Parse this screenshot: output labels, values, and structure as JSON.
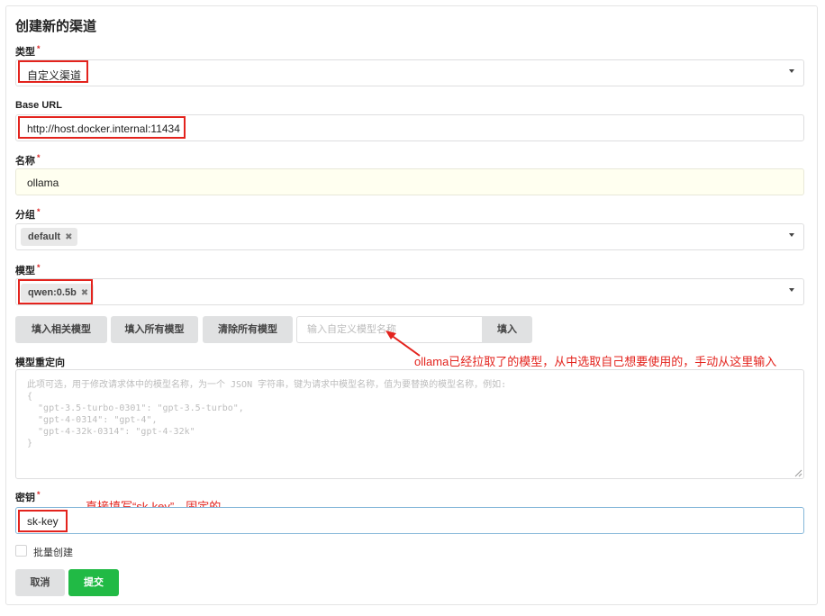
{
  "page": {
    "title": "创建新的渠道"
  },
  "form": {
    "type": {
      "label": "类型",
      "required_mark": "*",
      "value": "自定义渠道"
    },
    "base_url": {
      "label": "Base URL",
      "value": "http://host.docker.internal:11434"
    },
    "name": {
      "label": "名称",
      "required_mark": "*",
      "value": "ollama"
    },
    "group": {
      "label": "分组",
      "required_mark": "*",
      "chips": [
        "default"
      ],
      "chip_remove": "✖"
    },
    "model": {
      "label": "模型",
      "required_mark": "*",
      "chips": [
        "qwen:0.5b"
      ],
      "chip_remove": "✖"
    },
    "model_buttons": {
      "fill_related": "填入相关模型",
      "fill_all": "填入所有模型",
      "clear_all": "清除所有模型",
      "custom_placeholder": "输入自定义模型名称",
      "fill": "填入"
    },
    "model_mapping": {
      "label": "模型重定向",
      "placeholder": "此项可选，用于修改请求体中的模型名称，为一个 JSON 字符串，键为请求中模型名称，值为要替换的模型名称，例如:\n{\n  \"gpt-3.5-turbo-0301\": \"gpt-3.5-turbo\",\n  \"gpt-4-0314\": \"gpt-4\",\n  \"gpt-4-32k-0314\": \"gpt-4-32k\"\n}"
    },
    "key": {
      "label": "密钥",
      "required_mark": "*",
      "value": "sk-key"
    },
    "batch_create": {
      "label": "批量创建"
    },
    "actions": {
      "cancel": "取消",
      "submit": "提交"
    }
  },
  "annotations": {
    "model_note": "ollama已经拉取了的模型，从中选取自己想要使用的，手动从这里输入",
    "key_note": "直接填写“sk-key”，固定的"
  },
  "colors": {
    "highlight": "#e3231d",
    "submit_green": "#21ba45",
    "name_field_bg": "#fffff0"
  },
  "icons": {
    "dropdown": "caret-down-icon",
    "chip_remove": "close-icon",
    "resize": "resize-handle-icon",
    "arrow": "arrow-icon"
  }
}
